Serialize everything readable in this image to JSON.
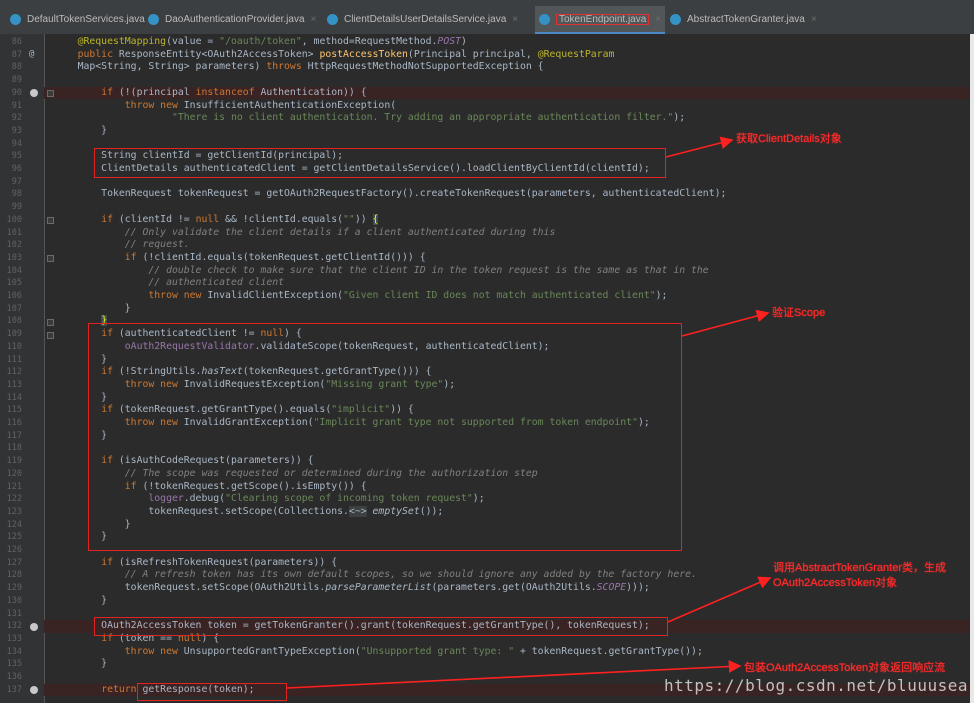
{
  "tabs": [
    {
      "label": "DefaultTokenServices.java",
      "type": "class"
    },
    {
      "label": "DaoAuthenticationProvider.java",
      "type": "class"
    },
    {
      "label": "ClientDetailsUserDetailsService.java",
      "type": "class"
    },
    {
      "label": "TokenEndpoint.java",
      "type": "class",
      "active": true
    },
    {
      "label": "AbstractTokenGranter.java",
      "type": "class"
    }
  ],
  "tab_close_glyph": "×",
  "gutter": {
    "line_numbers": [
      "86",
      "87",
      "88",
      "89",
      "90",
      "91",
      "92",
      "93",
      "94",
      "95",
      "96",
      "97",
      "98",
      "99",
      "100",
      "101",
      "102",
      "103",
      "104",
      "105",
      "106",
      "107",
      "108",
      "109",
      "110",
      "111",
      "112",
      "113",
      "114",
      "115",
      "116",
      "117",
      "118",
      "119",
      "120",
      "121",
      "122",
      "123",
      "124",
      "125",
      "126",
      "127",
      "128",
      "129",
      "130",
      "131",
      "132",
      "133",
      "134",
      "135",
      "136",
      "137"
    ],
    "breakpoint_lines": [
      "90",
      "132",
      "137"
    ],
    "override_marker_line": "87",
    "override_marker_glyph": "@"
  },
  "code_lines": [
    {
      "n": "86",
      "html": "    <span class=\"ann\">@RequestMapping</span>(value = <span class=\"str\">\"/oauth/token\"</span>, method=RequestMethod.<span class=\"gid\">POST</span>)"
    },
    {
      "n": "87",
      "html": "    <span class=\"kw\">public</span> ResponseEntity&lt;OAuth2AccessToken&gt; <span class=\"fn\">postAccessToken</span>(Principal principal, <span class=\"ann\">@RequestParam</span>"
    },
    {
      "n": "88",
      "html": "    Map&lt;String, String&gt; parameters) <span class=\"kw\">throws</span> HttpRequestMethodNotSupportedException {"
    },
    {
      "n": "89",
      "html": ""
    },
    {
      "n": "90",
      "html": "        <span class=\"kw\">if</span> (!(principal <span class=\"kw\">instanceof</span> Authentication)) {",
      "hl": true
    },
    {
      "n": "91",
      "html": "            <span class=\"kw\">throw new</span> InsufficientAuthenticationException("
    },
    {
      "n": "92",
      "html": "                    <span class=\"str\">\"There is no client authentication. Try adding an appropriate authentication filter.\"</span>);"
    },
    {
      "n": "93",
      "html": "        }"
    },
    {
      "n": "94",
      "html": ""
    },
    {
      "n": "95",
      "html": "        String clientId = getClientId(principal);"
    },
    {
      "n": "96",
      "html": "        ClientDetails authenticatedClient = getClientDetailsService().loadClientByClientId(clientId);"
    },
    {
      "n": "97",
      "html": ""
    },
    {
      "n": "98",
      "html": "        TokenRequest tokenRequest = getOAuth2RequestFactory().createTokenRequest(parameters, authenticatedClient);"
    },
    {
      "n": "99",
      "html": ""
    },
    {
      "n": "100",
      "html": "        <span class=\"kw\">if</span> (clientId != <span class=\"kw\">null</span> &amp;&amp; !clientId.equals(<span class=\"str\">\"\"</span>)) <span style=\"background:#3b514d;color:#ffef28\">{</span>"
    },
    {
      "n": "101",
      "html": "            <span class=\"cm\">// Only validate the client details if a client authenticated during this</span>"
    },
    {
      "n": "102",
      "html": "            <span class=\"cm\">// request.</span>"
    },
    {
      "n": "103",
      "html": "            <span class=\"kw\">if</span> (!clientId.equals(tokenRequest.getClientId())) {"
    },
    {
      "n": "104",
      "html": "                <span class=\"cm\">// double check to make sure that the client ID in the token request is the same as that in the</span>"
    },
    {
      "n": "105",
      "html": "                <span class=\"cm\">// authenticated client</span>"
    },
    {
      "n": "106",
      "html": "                <span class=\"kw\">throw new</span> InvalidClientException(<span class=\"str\">\"Given client ID does not match authenticated client\"</span>);"
    },
    {
      "n": "107",
      "html": "            }"
    },
    {
      "n": "108",
      "html": "        <span style=\"background:#3b514d;color:#ffef28\">}</span>"
    },
    {
      "n": "109",
      "html": "        <span class=\"kw\">if</span> (authenticatedClient != <span class=\"kw\">null</span>) {"
    },
    {
      "n": "110",
      "html": "            <span class=\"fld\">oAuth2RequestValidator</span>.validateScope(tokenRequest, authenticatedClient);"
    },
    {
      "n": "111",
      "html": "        }"
    },
    {
      "n": "112",
      "html": "        <span class=\"kw\">if</span> (!StringUtils.<span class=\"itl\">hasText</span>(tokenRequest.getGrantType())) {"
    },
    {
      "n": "113",
      "html": "            <span class=\"kw\">throw new</span> InvalidRequestException(<span class=\"str\">\"Missing grant type\"</span>);"
    },
    {
      "n": "114",
      "html": "        }"
    },
    {
      "n": "115",
      "html": "        <span class=\"kw\">if</span> (tokenRequest.getGrantType().equals(<span class=\"str\">\"implicit\"</span>)) {"
    },
    {
      "n": "116",
      "html": "            <span class=\"kw\">throw new</span> InvalidGrantException(<span class=\"str\">\"Implicit grant type not supported from token endpoint\"</span>);"
    },
    {
      "n": "117",
      "html": "        }"
    },
    {
      "n": "118",
      "html": ""
    },
    {
      "n": "119",
      "html": "        <span class=\"kw\">if</span> (isAuthCodeRequest(parameters)) {"
    },
    {
      "n": "120",
      "html": "            <span class=\"cm\">// The scope was requested or determined during the authorization step</span>"
    },
    {
      "n": "121",
      "html": "            <span class=\"kw\">if</span> (!tokenRequest.getScope().isEmpty()) {"
    },
    {
      "n": "122",
      "html": "                <span class=\"fld\">logger</span>.debug(<span class=\"str\">\"Clearing scope of incoming token request\"</span>);"
    },
    {
      "n": "123",
      "html": "                tokenRequest.setScope(Collections.<span class=\"fold-hint\">&lt;~&gt;</span> <span class=\"itl\">emptySet</span>());"
    },
    {
      "n": "124",
      "html": "            }"
    },
    {
      "n": "125",
      "html": "        }"
    },
    {
      "n": "126",
      "html": ""
    },
    {
      "n": "127",
      "html": "        <span class=\"kw\">if</span> (isRefreshTokenRequest(parameters)) {"
    },
    {
      "n": "128",
      "html": "            <span class=\"cm\">// A refresh token has its own default scopes, so we should ignore any added by the factory here.</span>"
    },
    {
      "n": "129",
      "html": "            tokenRequest.setScope(OAuth2Utils.<span class=\"itl\">parseParameterList</span>(parameters.get(OAuth2Utils.<span class=\"gid\">SCOPE</span>)));"
    },
    {
      "n": "130",
      "html": "        }"
    },
    {
      "n": "131",
      "html": ""
    },
    {
      "n": "132",
      "html": "        OAuth2AccessToken token = getTokenGranter().grant(tokenRequest.getGrantType(), tokenRequest);",
      "hl": true
    },
    {
      "n": "133",
      "html": "        <span class=\"kw\">if</span> (token == <span class=\"kw\">null</span>) {"
    },
    {
      "n": "134",
      "html": "            <span class=\"kw\">throw new</span> UnsupportedGrantTypeException(<span class=\"str\">\"Unsupported grant type: \"</span> + tokenRequest.getGrantType());"
    },
    {
      "n": "135",
      "html": "        }"
    },
    {
      "n": "136",
      "html": ""
    },
    {
      "n": "137",
      "html": "        <span class=\"kw\">return</span> getResponse(token);",
      "hl": true
    }
  ],
  "annotations": [
    {
      "text": "获取ClientDetails对象"
    },
    {
      "text": "验证Scope"
    },
    {
      "text": "调用AbstractTokenGranter类，生成\nOAuth2AccessToken对象"
    },
    {
      "text": "包装OAuth2AccessToken对象返回响应流"
    }
  ],
  "watermark": "https://blog.csdn.net/bluuusea",
  "colors": {
    "editor_bg": "#2b2b2b",
    "gutter_bg": "#313335",
    "keyword": "#cc7832",
    "string": "#6a8759",
    "comment": "#808080",
    "annotation_red": "#e32222"
  }
}
